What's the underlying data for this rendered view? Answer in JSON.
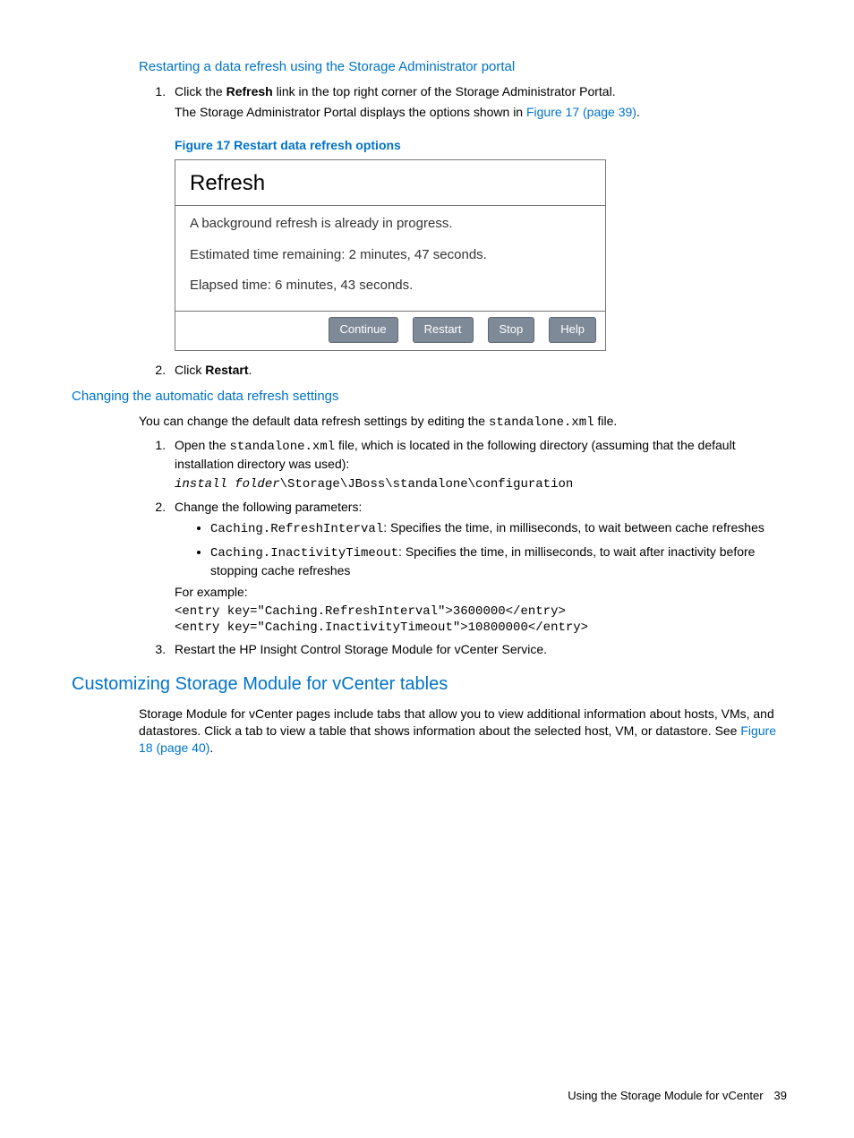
{
  "sec1": {
    "heading": "Restarting a data refresh using the Storage Administrator portal",
    "step1_a": "Click the ",
    "step1_b": "Refresh",
    "step1_c": " link in the top right corner of the Storage Administrator Portal.",
    "step1_line2_a": "The Storage Administrator Portal displays the options shown in ",
    "step1_line2_link": "Figure 17 (page 39)",
    "step1_line2_b": ".",
    "figCaption": "Figure 17 Restart data refresh options",
    "step2_a": "Click ",
    "step2_b": "Restart",
    "step2_c": "."
  },
  "dialog": {
    "title": "Refresh",
    "l1": "A background refresh is already in progress.",
    "l2": "Estimated time remaining: 2 minutes, 47 seconds.",
    "l3": "Elapsed time: 6 minutes, 43 seconds.",
    "btnContinue": "Continue",
    "btnRestart": "Restart",
    "btnStop": "Stop",
    "btnHelp": "Help"
  },
  "sec2": {
    "heading": "Changing the automatic data refresh settings",
    "intro_a": "You can change the default data refresh settings by editing the ",
    "intro_file": "standalone.xml",
    "intro_b": " file.",
    "s1_a": "Open the ",
    "s1_file": "standalone.xml",
    "s1_b": " file, which is located in the following directory (assuming that the default installation directory was used):",
    "s1_path_var": "install folder",
    "s1_path_rest": "\\Storage\\JBoss\\standalone\\configuration",
    "s2": "Change the following parameters:",
    "p1_code": "Caching.RefreshInterval",
    "p1_text": ": Specifies the time, in milliseconds, to wait between cache refreshes",
    "p2_code": "Caching.InactivityTimeout",
    "p2_text": ": Specifies the time, in milliseconds, to wait after inactivity before stopping cache refreshes",
    "forExample": "For example:",
    "code": "<entry key=\"Caching.RefreshInterval\">3600000</entry>\n<entry key=\"Caching.InactivityTimeout\">10800000</entry>",
    "s3": "Restart the HP Insight Control Storage Module for vCenter Service."
  },
  "sec3": {
    "heading": "Customizing Storage Module for vCenter tables",
    "body_a": "Storage Module for vCenter pages include tabs that allow you to view additional information about hosts, VMs, and datastores. Click a tab to view a table that shows information about the selected host, VM, or datastore. See ",
    "body_link": "Figure 18 (page 40)",
    "body_b": "."
  },
  "footer": {
    "text": "Using the Storage Module for vCenter",
    "page": "39"
  }
}
